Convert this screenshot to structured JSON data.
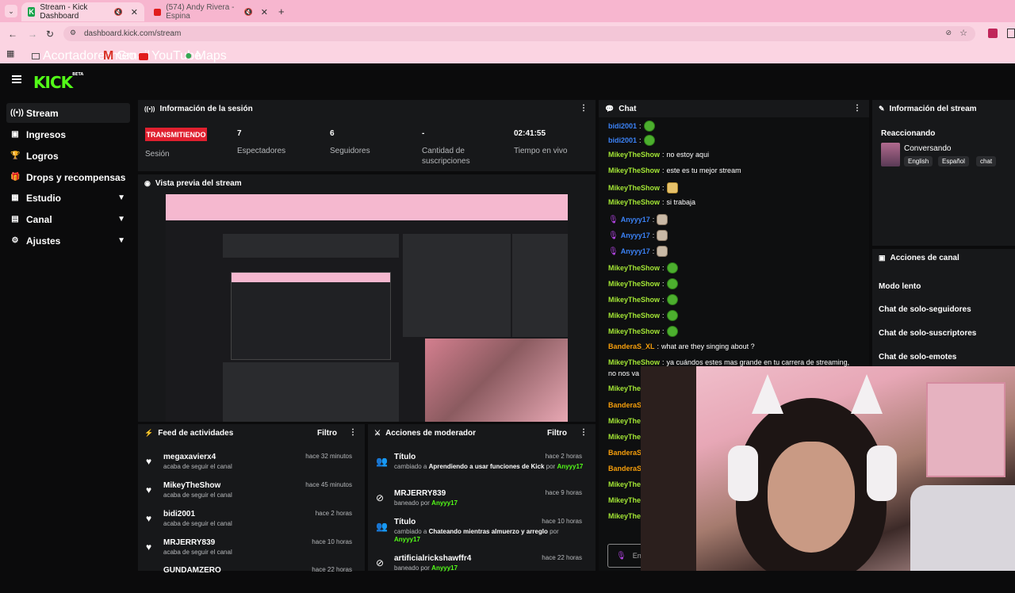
{
  "browser": {
    "tabs": [
      {
        "title": "Stream - Kick Dashboard",
        "active": true
      },
      {
        "title": "(574) Andy Rivera - Espina",
        "active": false
      }
    ],
    "url": "dashboard.kick.com/stream",
    "bookmarks": [
      "Acortadoresmeo",
      "Gmail",
      "YouTube",
      "Maps"
    ]
  },
  "app": {
    "logo": "KICK",
    "logo_badge": "BETA"
  },
  "sidebar": {
    "items": [
      {
        "label": "Stream",
        "icon": "broadcast-icon",
        "active": true
      },
      {
        "label": "Ingresos",
        "icon": "wallet-icon"
      },
      {
        "label": "Logros",
        "icon": "trophy-icon"
      },
      {
        "label": "Drops y recompensas",
        "icon": "gift-icon"
      },
      {
        "label": "Estudio",
        "icon": "grid-icon",
        "expandable": true
      },
      {
        "label": "Canal",
        "icon": "calendar-icon",
        "expandable": true
      },
      {
        "label": "Ajustes",
        "icon": "gear-icon",
        "expandable": true
      }
    ]
  },
  "session": {
    "title": "Información de la sesión",
    "status_badge": "TRANSMITIENDO",
    "status_label": "Sesión",
    "stats": [
      {
        "value": "7",
        "label": "Espectadores"
      },
      {
        "value": "6",
        "label": "Seguidores"
      },
      {
        "value": "-",
        "label": "Cantidad de suscripciones"
      },
      {
        "value": "02:41:55",
        "label": "Tiempo en vivo"
      }
    ]
  },
  "preview": {
    "title": "Vista previa del stream"
  },
  "feed": {
    "title": "Feed de actividades",
    "filter": "Filtro",
    "items": [
      {
        "name": "megaxavierx4",
        "sub": "acaba de seguir el canal",
        "time": "hace 32 minutos"
      },
      {
        "name": "MikeyTheShow",
        "sub": "acaba de seguir el canal",
        "time": "hace 45 minutos"
      },
      {
        "name": "bidi2001",
        "sub": "acaba de seguir el canal",
        "time": "hace 2 horas"
      },
      {
        "name": "MRJERRY839",
        "sub": "acaba de seguir el canal",
        "time": "hace 10 horas"
      },
      {
        "name": "GUNDAMZERO",
        "sub": "",
        "time": "hace 22 horas"
      }
    ]
  },
  "mod": {
    "title": "Acciones de moderador",
    "filter": "Filtro",
    "items": [
      {
        "icon": "users-icon",
        "name": "Título",
        "prefix": "cambiado a",
        "detail": "Aprendiendo a usar funciones de Kick",
        "suffix": "por",
        "by": "Anyyy17",
        "time": "hace 2 horas"
      },
      {
        "icon": "ban-icon",
        "name": "MRJERRY839",
        "prefix": "baneado por",
        "detail": "",
        "suffix": "",
        "by": "Anyyy17",
        "time": "hace 9 horas"
      },
      {
        "icon": "users-icon",
        "name": "Título",
        "prefix": "cambiado a",
        "detail": "Chateando mientras almuerzo y arreglo",
        "suffix": "por",
        "by": "Anyyy17",
        "time": "hace 10 horas"
      },
      {
        "icon": "ban-icon",
        "name": "artificialrickshawffr4",
        "prefix": "baneado por",
        "detail": "",
        "suffix": "",
        "by": "Anyyy17",
        "time": "hace 22 horas"
      }
    ]
  },
  "chat": {
    "title": "Chat",
    "messages": [
      {
        "user": "bidi2001",
        "text": "",
        "emote": "green",
        "color": "#3b82f6"
      },
      {
        "user": "bidi2001",
        "text": "",
        "emote": "green",
        "color": "#3b82f6"
      },
      {
        "user": "MikeyTheShow",
        "text": "no estoy aqui",
        "emote": "",
        "color": "#a3e635"
      },
      {
        "user": "MikeyTheShow",
        "text": "este es tu mejor stream",
        "emote": "",
        "color": "#a3e635"
      },
      {
        "user": "MikeyTheShow",
        "text": "",
        "emote": "gold",
        "color": "#a3e635"
      },
      {
        "user": "MikeyTheShow",
        "text": "si trabaja",
        "emote": "",
        "color": "#a3e635"
      },
      {
        "user": "Anyyy17",
        "text": "",
        "emote": "cat",
        "color": "#3b82f6",
        "mic": true
      },
      {
        "user": "Anyyy17",
        "text": "",
        "emote": "cat",
        "color": "#3b82f6",
        "mic": true
      },
      {
        "user": "Anyyy17",
        "text": "",
        "emote": "cat",
        "color": "#3b82f6",
        "mic": true
      },
      {
        "user": "MikeyTheShow",
        "text": "",
        "emote": "green",
        "color": "#a3e635"
      },
      {
        "user": "MikeyTheShow",
        "text": "",
        "emote": "green",
        "color": "#a3e635"
      },
      {
        "user": "MikeyTheShow",
        "text": "",
        "emote": "green",
        "color": "#a3e635"
      },
      {
        "user": "MikeyTheShow",
        "text": "",
        "emote": "green",
        "color": "#a3e635"
      },
      {
        "user": "MikeyTheShow",
        "text": "",
        "emote": "green",
        "color": "#a3e635"
      },
      {
        "user": "BanderaS_XL",
        "text": "what are they singing about ?",
        "emote": "",
        "color": "#f59e0b"
      },
      {
        "user": "MikeyTheShow",
        "text": "ya cuándos estes mas grande en tu carrera de streaming,",
        "emote": "",
        "color": "#a3e635"
      },
      {
        "user": "",
        "text": "no nos va",
        "emote": "",
        "color": "#fff"
      },
      {
        "user": "MikeyThe",
        "text": "",
        "emote": "",
        "color": "#a3e635"
      },
      {
        "user": "BanderaS",
        "text": "",
        "emote": "",
        "color": "#f59e0b"
      },
      {
        "user": "MikeyThe",
        "text": "",
        "emote": "",
        "color": "#a3e635"
      },
      {
        "user": "MikeyThe",
        "text": "",
        "emote": "",
        "color": "#a3e635"
      },
      {
        "user": "BanderaS",
        "text": "",
        "emote": "",
        "color": "#f59e0b"
      },
      {
        "user": "BanderaS",
        "text": "",
        "emote": "",
        "color": "#f59e0b"
      },
      {
        "user": "MikeyThe",
        "text": "",
        "emote": "",
        "color": "#a3e635"
      },
      {
        "user": "MikeyThe",
        "text": "",
        "emote": "",
        "color": "#a3e635"
      },
      {
        "user": "MikeyThe",
        "text": "",
        "emote": "",
        "color": "#a3e635"
      }
    ],
    "input_placeholder": "En"
  },
  "stream_info": {
    "title": "Información del stream",
    "stream_title": "Reaccionando",
    "category": "Conversando",
    "tags": [
      "English",
      "Español",
      "chat"
    ]
  },
  "channel_actions": {
    "title": "Acciones de canal",
    "items": [
      "Modo lento",
      "Chat de solo-seguidores",
      "Chat de solo-suscriptores",
      "Chat de solo-emotes"
    ]
  },
  "colors": {
    "brand": "#53fc18",
    "live": "#e0202f",
    "chrome": "#f7b6cf"
  }
}
